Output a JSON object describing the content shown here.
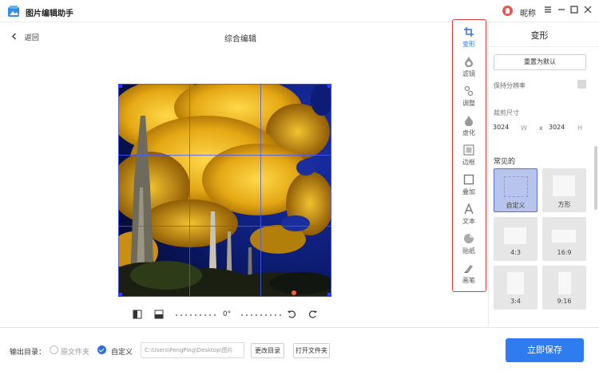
{
  "app": {
    "title": "图片编辑助手",
    "nickname": "昵称"
  },
  "toolbar": {
    "back_label": "返回",
    "page_title": "综合编辑"
  },
  "edit_controls": {
    "rotate_value": "0°"
  },
  "tools": [
    {
      "label": "变形",
      "icon": "crop-icon",
      "active": true
    },
    {
      "label": "滤镜",
      "icon": "filter-icon",
      "active": false
    },
    {
      "label": "调整",
      "icon": "adjust-icon",
      "active": false
    },
    {
      "label": "虚化",
      "icon": "blur-icon",
      "active": false
    },
    {
      "label": "边框",
      "icon": "border-icon",
      "active": false
    },
    {
      "label": "叠加",
      "icon": "overlay-icon",
      "active": false
    },
    {
      "label": "文本",
      "icon": "text-icon",
      "active": false
    },
    {
      "label": "贴纸",
      "icon": "sticker-icon",
      "active": false
    },
    {
      "label": "画笔",
      "icon": "brush-icon",
      "active": false
    }
  ],
  "panel": {
    "title": "变形",
    "reset_label": "重置为默认",
    "keep_ratio_label": "保持分辨率",
    "crop_size_label": "裁剪尺寸",
    "width": "3024",
    "width_unit": "W",
    "times": "x",
    "height": "3024",
    "height_unit": "H",
    "common_label": "常见的",
    "presets": [
      "自定义",
      "方形",
      "4:3",
      "16:9",
      "3:4",
      "9:16"
    ]
  },
  "bottom": {
    "output_label": "输出目录：",
    "original_folder_label": "原文件夹",
    "custom_label": "自定义",
    "path_value": "C:\\Users\\FengPing\\Desktop\\图片",
    "change_dir_label": "更改目录",
    "open_folder_label": "打开文件夹",
    "save_label": "立即保存"
  },
  "colors": {
    "accent": "#2f7bf0",
    "highlight_border": "#e33b3b",
    "tree_yellow": "#e8b41a",
    "night_sky": "#0b1b6e"
  }
}
